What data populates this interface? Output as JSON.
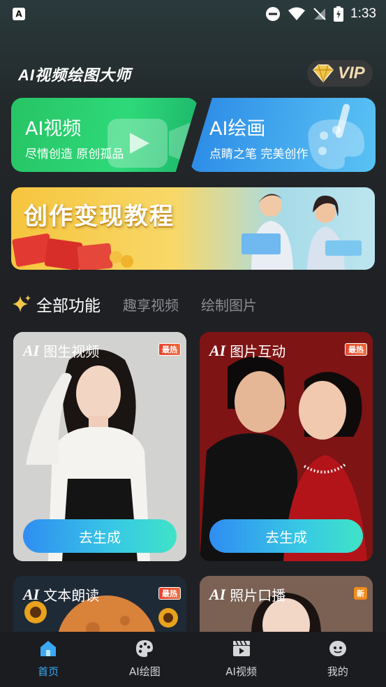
{
  "status_bar": {
    "time": "1:33",
    "app_icon_glyph": "A",
    "icons": [
      "dnd-icon",
      "wifi-icon",
      "no-signal-icon",
      "battery-charging-icon"
    ]
  },
  "header": {
    "app_title": "AI视频绘图大师",
    "vip_label": "VIP"
  },
  "features": {
    "video": {
      "title": "AI视频",
      "subtitle": "尽情创造 原创孤品",
      "icon": "video-camera-icon"
    },
    "paint": {
      "title": "AI绘画",
      "subtitle": "点睛之笔 完美创作",
      "icon": "palette-brush-icon"
    }
  },
  "banner": {
    "text": "创作变现教程"
  },
  "tabs": {
    "sparkle_icon": "sparkle-icon",
    "items": [
      "全部功能",
      "趣享视频",
      "绘制图片"
    ]
  },
  "cards": [
    {
      "title": "图生视频",
      "badge": "最热",
      "button": "去生成"
    },
    {
      "title": "图片互动",
      "badge": "最热",
      "button": "去生成"
    },
    {
      "title": "文本朗读",
      "badge": "最热"
    },
    {
      "title": "照片口播",
      "badge": "新"
    }
  ],
  "ai_logo": "AI",
  "bottom_nav": {
    "items": [
      {
        "label": "首页",
        "icon": "home-icon"
      },
      {
        "label": "AI绘图",
        "icon": "palette-icon"
      },
      {
        "label": "AI视频",
        "icon": "clapperboard-icon"
      },
      {
        "label": "我的",
        "icon": "profile-icon"
      }
    ]
  },
  "colors": {
    "accent": "#3aa8f3",
    "background": "#1f2024",
    "video_card": "#2ed979",
    "paint_card": "#4db3f0",
    "hot_badge": "#e8432f",
    "new_badge": "#f08c1e"
  }
}
